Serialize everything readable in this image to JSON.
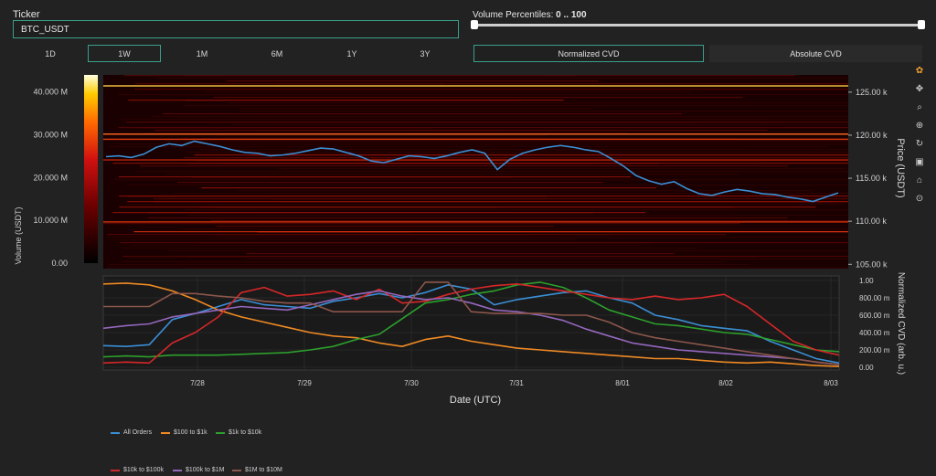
{
  "ticker": {
    "label": "Ticker",
    "value": "BTC_USDT"
  },
  "volume_percentiles": {
    "label": "Volume Percentiles: ",
    "value": "0 .. 100",
    "low": 0,
    "high": 100
  },
  "ranges": [
    {
      "label": "1D",
      "active": false
    },
    {
      "label": "1W",
      "active": true
    },
    {
      "label": "1M",
      "active": false
    },
    {
      "label": "6M",
      "active": false
    },
    {
      "label": "1Y",
      "active": false
    },
    {
      "label": "3Y",
      "active": false
    }
  ],
  "modes": [
    {
      "label": "Normalized CVD",
      "active": true
    },
    {
      "label": "Absolute CVD",
      "active": false
    }
  ],
  "toolbar": [
    {
      "name": "plotly-logo-icon",
      "glyph": "✿"
    },
    {
      "name": "pan-icon",
      "glyph": "✥"
    },
    {
      "name": "zoom-icon",
      "glyph": "⌕"
    },
    {
      "name": "zoom-in-icon",
      "glyph": "⊕"
    },
    {
      "name": "autoscale-icon",
      "glyph": "↻"
    },
    {
      "name": "download-icon",
      "glyph": "▣"
    },
    {
      "name": "reset-axes-icon",
      "glyph": "⌂"
    },
    {
      "name": "spike-lines-icon",
      "glyph": "⊙"
    }
  ],
  "chart_data": [
    {
      "type": "heatmap",
      "description_free": true,
      "colorbar": {
        "title": "Volume (USDT)",
        "ticks": [
          "40.000 M",
          "30.000 M",
          "20.000 M",
          "10.000 M",
          "0.00"
        ],
        "range": [
          0,
          44000000
        ]
      },
      "y_right": {
        "title": "Price (USDT)",
        "ticks": [
          "125.00 k",
          "120.00 k",
          "115.00 k",
          "110.00 k",
          "105.00 k"
        ],
        "range": [
          104500,
          127000
        ]
      },
      "price_line_color": "#3a8fd6",
      "price_series": [
        117.5,
        117.6,
        117.4,
        117.8,
        118.6,
        119.0,
        118.8,
        119.3,
        119.0,
        118.7,
        118.3,
        118.0,
        117.9,
        117.6,
        117.7,
        117.9,
        118.2,
        118.5,
        118.4,
        118.0,
        117.6,
        117.0,
        116.8,
        117.2,
        117.6,
        117.5,
        117.3,
        117.6,
        118.0,
        118.3,
        117.9,
        116.0,
        117.2,
        117.9,
        118.3,
        118.6,
        118.8,
        118.6,
        118.3,
        118.1,
        117.3,
        116.4,
        115.3,
        114.7,
        114.3,
        114.6,
        113.8,
        113.2,
        113.0,
        113.4,
        113.7,
        113.5,
        113.2,
        113.1,
        112.8,
        112.6,
        112.3,
        112.8,
        113.3
      ]
    },
    {
      "type": "line",
      "x_ticks": [
        "7/28",
        "7/29",
        "7/30",
        "7/31",
        "8/01",
        "8/02",
        "8/03"
      ],
      "xlabel": "Date (UTC)",
      "ylabel": "Normalized CVD (arb. u.)",
      "y_ticks": [
        "1.00",
        "800.00 m",
        "600.00 m",
        "400.00 m",
        "200.00 m",
        "0.00"
      ],
      "ylim": [
        0,
        1
      ],
      "series": [
        {
          "name": "All Orders",
          "color": "#3a8fd6",
          "values": [
            0.25,
            0.24,
            0.26,
            0.55,
            0.62,
            0.7,
            0.78,
            0.72,
            0.7,
            0.68,
            0.76,
            0.8,
            0.85,
            0.8,
            0.86,
            0.95,
            0.9,
            0.72,
            0.78,
            0.82,
            0.86,
            0.88,
            0.8,
            0.74,
            0.6,
            0.55,
            0.48,
            0.45,
            0.42,
            0.3,
            0.2,
            0.1,
            0.05
          ]
        },
        {
          "name": "$100 to $1k",
          "color": "#f08a24",
          "values": [
            0.96,
            0.97,
            0.95,
            0.88,
            0.78,
            0.66,
            0.58,
            0.52,
            0.46,
            0.4,
            0.36,
            0.34,
            0.28,
            0.24,
            0.32,
            0.36,
            0.3,
            0.26,
            0.22,
            0.2,
            0.18,
            0.16,
            0.14,
            0.12,
            0.1,
            0.1,
            0.08,
            0.06,
            0.05,
            0.06,
            0.04,
            0.02,
            0.01
          ]
        },
        {
          "name": "$1k to $10k",
          "color": "#2ca02c",
          "values": [
            0.12,
            0.13,
            0.12,
            0.14,
            0.14,
            0.14,
            0.15,
            0.16,
            0.17,
            0.2,
            0.24,
            0.32,
            0.38,
            0.56,
            0.74,
            0.78,
            0.84,
            0.88,
            0.95,
            0.98,
            0.92,
            0.8,
            0.66,
            0.58,
            0.5,
            0.48,
            0.44,
            0.4,
            0.38,
            0.32,
            0.26,
            0.2,
            0.18
          ]
        },
        {
          "name": "$10k to $100k",
          "color": "#d62728",
          "values": [
            0.05,
            0.06,
            0.05,
            0.28,
            0.4,
            0.58,
            0.86,
            0.92,
            0.82,
            0.84,
            0.88,
            0.78,
            0.9,
            0.74,
            0.76,
            0.84,
            0.9,
            0.94,
            0.96,
            0.92,
            0.88,
            0.84,
            0.8,
            0.78,
            0.82,
            0.78,
            0.8,
            0.84,
            0.7,
            0.5,
            0.3,
            0.2,
            0.14
          ]
        },
        {
          "name": "$100k to $1M",
          "color": "#9467bd",
          "values": [
            0.45,
            0.48,
            0.5,
            0.58,
            0.62,
            0.66,
            0.7,
            0.68,
            0.66,
            0.72,
            0.78,
            0.84,
            0.88,
            0.82,
            0.78,
            0.8,
            0.74,
            0.66,
            0.64,
            0.6,
            0.54,
            0.44,
            0.36,
            0.28,
            0.24,
            0.2,
            0.18,
            0.16,
            0.14,
            0.12,
            0.1,
            0.06,
            0.03
          ]
        },
        {
          "name": "$1M to $10M",
          "color": "#8c564b",
          "values": [
            0.7,
            0.7,
            0.7,
            0.85,
            0.85,
            0.82,
            0.8,
            0.76,
            0.74,
            0.74,
            0.64,
            0.64,
            0.64,
            0.64,
            0.98,
            0.98,
            0.64,
            0.62,
            0.62,
            0.62,
            0.6,
            0.6,
            0.52,
            0.4,
            0.34,
            0.3,
            0.26,
            0.22,
            0.18,
            0.14,
            0.1,
            0.06,
            0.03
          ]
        }
      ]
    }
  ]
}
